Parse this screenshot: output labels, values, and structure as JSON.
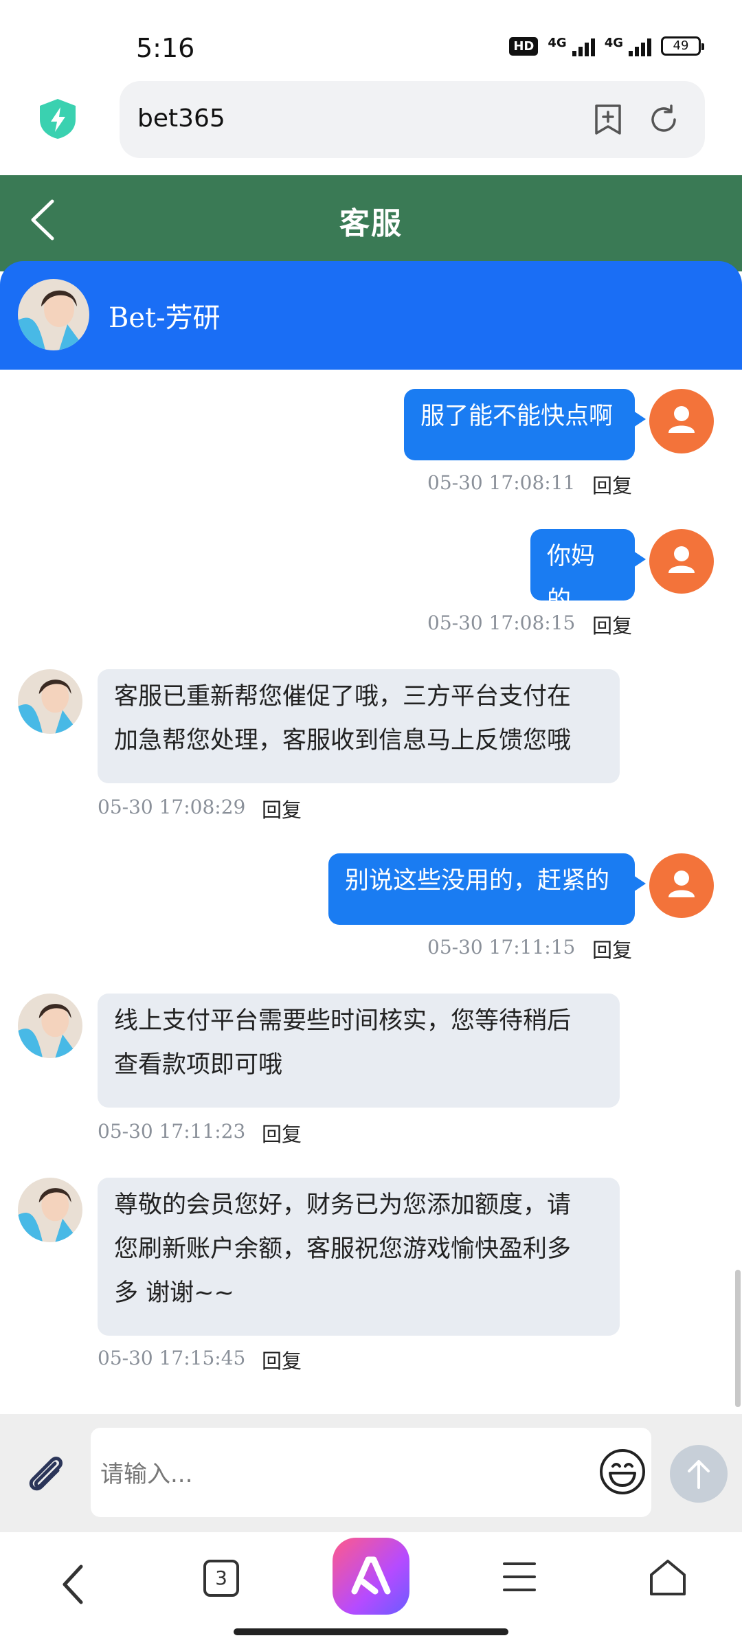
{
  "status_bar": {
    "time": "5:16",
    "hd_label": "HD",
    "network_1": "4G",
    "network_2": "4G",
    "battery": "49"
  },
  "browser": {
    "url": "bet365"
  },
  "header": {
    "title": "客服"
  },
  "agent": {
    "name": "Bet-芳研"
  },
  "messages": [
    {
      "side": "out",
      "text": "服了能不能快点啊",
      "time": "05-30 17:08:11",
      "reply": "回复"
    },
    {
      "side": "out",
      "text": "你妈的",
      "time": "05-30 17:08:15",
      "reply": "回复"
    },
    {
      "side": "in",
      "lines": [
        "客服已重新帮您催促了哦，三方平台支付在",
        "加急帮您处理，客服收到信息马上反馈您哦"
      ],
      "time": "05-30 17:08:29",
      "reply": "回复"
    },
    {
      "side": "out",
      "text": "别说这些没用的，赶紧的",
      "time": "05-30 17:11:15",
      "reply": "回复"
    },
    {
      "side": "in",
      "lines": [
        "线上支付平台需要些时间核实，您等待稍后",
        "查看款项即可哦"
      ],
      "time": "05-30 17:11:23",
      "reply": "回复"
    },
    {
      "side": "in",
      "lines": [
        "尊敬的会员您好，财务已为您添加额度，请",
        "您刷新账户余额，客服祝您游戏愉快盈利多",
        "多 谢谢~~"
      ],
      "time": "05-30 17:15:45",
      "reply": "回复"
    }
  ],
  "input": {
    "placeholder": "请输入..."
  },
  "nav": {
    "tab_count": "3"
  },
  "colors": {
    "header_green": "#3a7a55",
    "agent_blue": "#1a6ef5",
    "out_bubble": "#1a7cf2",
    "user_avatar": "#f3733a"
  }
}
